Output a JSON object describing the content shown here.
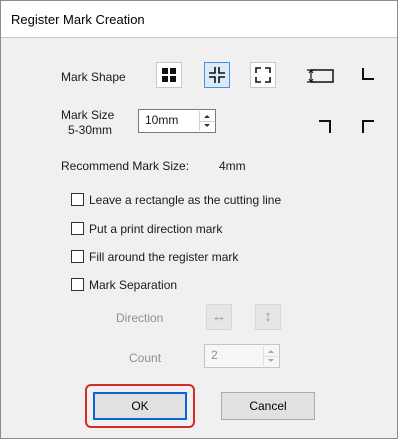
{
  "window": {
    "title": "Register Mark Creation"
  },
  "mark_shape": {
    "label": "Mark Shape",
    "options": [
      {
        "name": "filled-squares",
        "selected": false
      },
      {
        "name": "cross-corners",
        "selected": true
      },
      {
        "name": "outer-corners",
        "selected": false
      }
    ]
  },
  "mark_size": {
    "label_line1": "Mark Size",
    "label_line2": "5-30mm",
    "value": "10mm"
  },
  "recommend": {
    "label": "Recommend Mark Size:",
    "value": "4mm"
  },
  "options": [
    {
      "label": "Leave a rectangle as the cutting line",
      "checked": false
    },
    {
      "label": "Put a print direction mark",
      "checked": false
    },
    {
      "label": "Fill around the register mark",
      "checked": false
    },
    {
      "label": "Mark Separation",
      "checked": false
    }
  ],
  "separation": {
    "direction_label": "Direction",
    "count_label": "Count",
    "count_value": "2"
  },
  "buttons": {
    "ok": "OK",
    "cancel": "Cancel"
  },
  "colors": {
    "selection_border": "#4a8fd9",
    "focus_highlight": "#d42a2a",
    "default_button_border": "#0a64d8"
  }
}
